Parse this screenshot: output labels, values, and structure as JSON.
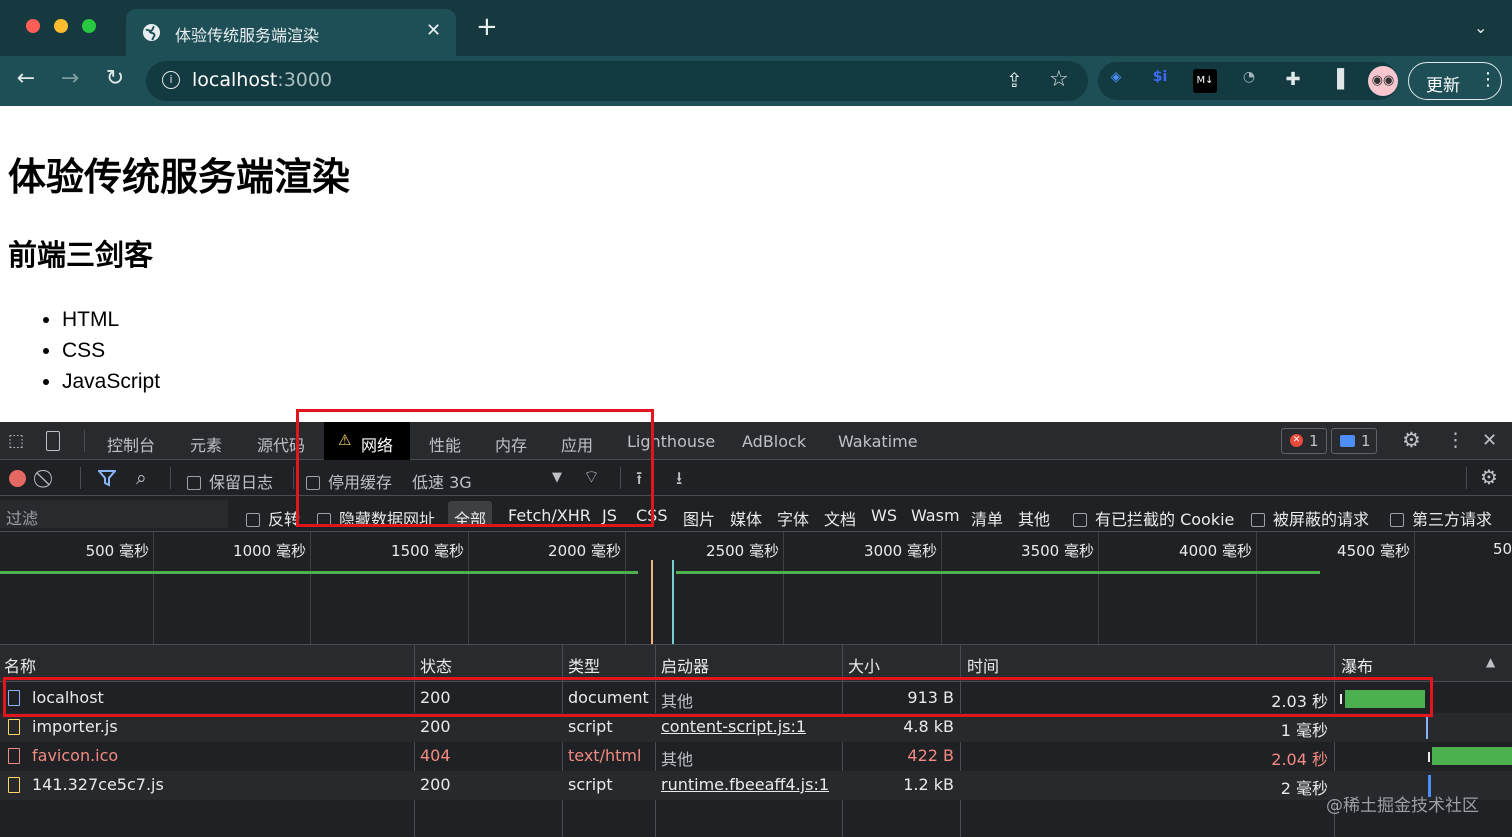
{
  "browser": {
    "tab_title": "体验传统服务端渲染",
    "url_host": "localhost",
    "url_port": ":3000",
    "update_label": "更新",
    "extensions": [
      "layers-icon",
      "si-icon",
      "markdown-icon",
      "timer-icon",
      "puzzle-icon",
      "sidebar-icon",
      "avatar"
    ]
  },
  "page": {
    "h1": "体验传统服务端渲染",
    "h2": "前端三剑客",
    "list": [
      "HTML",
      "CSS",
      "JavaScript"
    ]
  },
  "devtools": {
    "tabs": [
      "控制台",
      "元素",
      "源代码",
      "网络",
      "性能",
      "内存",
      "应用",
      "Lighthouse",
      "AdBlock",
      "Wakatime"
    ],
    "active_tab": "网络",
    "error_count": "1",
    "message_count": "1",
    "toolbar": {
      "preserve_log": "保留日志",
      "disable_cache": "停用缓存",
      "throttle": "低速 3G"
    },
    "filter": {
      "placeholder": "过滤",
      "invert": "反转",
      "hide_data_urls": "隐藏数据网址",
      "types": [
        "全部",
        "Fetch/XHR",
        "JS",
        "CSS",
        "图片",
        "媒体",
        "字体",
        "文档",
        "WS",
        "Wasm",
        "清单",
        "其他"
      ],
      "blocked_cookies": "有已拦截的 Cookie",
      "blocked_requests": "被屏蔽的请求",
      "third_party": "第三方请求"
    },
    "timeline_ticks": [
      "500 毫秒",
      "1000 毫秒",
      "1500 毫秒",
      "2000 毫秒",
      "2500 毫秒",
      "3000 毫秒",
      "3500 毫秒",
      "4000 毫秒",
      "4500 毫秒",
      "50"
    ],
    "columns": [
      "名称",
      "状态",
      "类型",
      "启动器",
      "大小",
      "时间",
      "瀑布"
    ],
    "requests": [
      {
        "name": "localhost",
        "status": "200",
        "type": "document",
        "initiator": "其他",
        "size": "913 B",
        "time": "2.03 秒",
        "error": false,
        "link": false
      },
      {
        "name": "importer.js",
        "status": "200",
        "type": "script",
        "initiator": "content-script.js:1",
        "size": "4.8 kB",
        "time": "1 毫秒",
        "error": false,
        "link": true
      },
      {
        "name": "favicon.ico",
        "status": "404",
        "type": "text/html",
        "initiator": "其他",
        "size": "422 B",
        "time": "2.04 秒",
        "error": true,
        "link": false
      },
      {
        "name": "141.327ce5c7.js",
        "status": "200",
        "type": "script",
        "initiator": "runtime.fbeeaff4.js:1",
        "size": "1.2 kB",
        "time": "2 毫秒",
        "error": false,
        "link": true
      }
    ],
    "watermark": "@稀土掘金技术社区"
  },
  "colors": {
    "accent_red": "#e3151c",
    "waterfall_green": "#4caf50",
    "error_text": "#f28b82"
  }
}
